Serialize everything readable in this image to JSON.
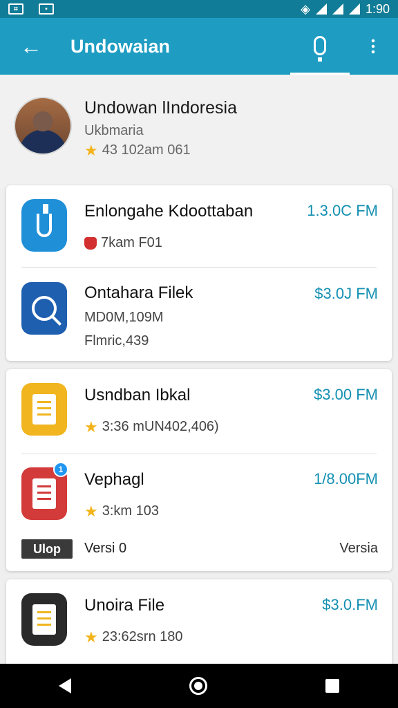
{
  "status_bar": {
    "time": "1:90",
    "left_icons": [
      "storage-icon",
      "notification-icon"
    ],
    "right_icons": [
      "wifi-icon",
      "signal-icon",
      "signal-icon",
      "battery-icon"
    ]
  },
  "app_bar": {
    "title": "Undowaian",
    "back_icon": "arrow-left-icon",
    "mic_icon": "microphone-icon",
    "more_icon": "more-vert-icon"
  },
  "profile": {
    "name": "Undowan lIndoresia",
    "subtitle": "Ukbmaria",
    "rating": "43 102am 061"
  },
  "cards": [
    {
      "items": [
        {
          "name": "Enlongahe Kdoottaban",
          "meta": "7kam F01",
          "price": "1.3.0C FM",
          "icon": "flask-icon"
        },
        {
          "name": "Ontahara Filek",
          "meta": "MD0M,109M",
          "extra": "Flmric,439",
          "price": "$3.0J FM",
          "icon": "search-icon"
        }
      ]
    },
    {
      "items": [
        {
          "name": "Usndban Ibkal",
          "meta": "3:36 mUN402,406)",
          "price": "$3.00 FM",
          "icon": "document-icon"
        },
        {
          "name": "Vephagl",
          "meta": "3:km 103",
          "price": "1/8.00FM",
          "icon": "document-badge-icon",
          "badge": "1",
          "chip": "Ulop",
          "version_left": "Versi 0",
          "version_right": "Versia"
        }
      ]
    },
    {
      "items": [
        {
          "name": "Unoira File",
          "meta": "23:62srn 180",
          "price": "$3.0.FM",
          "icon": "file-icon"
        }
      ]
    }
  ],
  "nav_bar": {
    "back_icon": "nav-back-icon",
    "home_icon": "nav-home-icon",
    "recent_icon": "nav-recent-icon"
  },
  "colors": {
    "status_bar": "#117c97",
    "app_bar": "#1e9cc2",
    "price": "#1490b2",
    "star": "#f3b31a"
  }
}
